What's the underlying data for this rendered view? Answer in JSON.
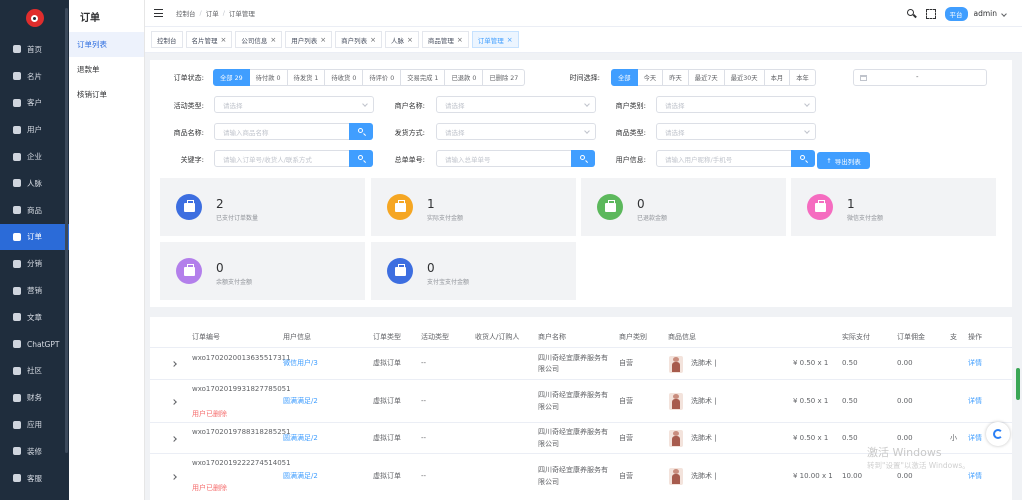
{
  "nav": {
    "items": [
      {
        "label": "首页",
        "icon": "home-icon"
      },
      {
        "label": "名片",
        "icon": "card-icon"
      },
      {
        "label": "客户",
        "icon": "customer-icon"
      },
      {
        "label": "用户",
        "icon": "user-icon"
      },
      {
        "label": "企业",
        "icon": "company-icon"
      },
      {
        "label": "人脉",
        "icon": "network-icon"
      },
      {
        "label": "商品",
        "icon": "goods-icon"
      },
      {
        "label": "订单",
        "icon": "order-icon",
        "active": true
      },
      {
        "label": "分销",
        "icon": "distribution-icon"
      },
      {
        "label": "营销",
        "icon": "marketing-icon"
      },
      {
        "label": "文章",
        "icon": "article-icon"
      },
      {
        "label": "ChatGPT",
        "icon": "chatgpt-icon"
      },
      {
        "label": "社区",
        "icon": "community-icon"
      },
      {
        "label": "财务",
        "icon": "finance-icon"
      },
      {
        "label": "应用",
        "icon": "apps-icon"
      },
      {
        "label": "装修",
        "icon": "decorate-icon"
      },
      {
        "label": "客服",
        "icon": "service-icon"
      }
    ]
  },
  "sub": {
    "title": "订单",
    "items": [
      {
        "label": "订单列表"
      },
      {
        "label": "退款单"
      },
      {
        "label": "核销订单"
      }
    ]
  },
  "header": {
    "breadcrumb": [
      "控制台",
      "订单",
      "订单管理"
    ],
    "platform": "平台",
    "user": "admin"
  },
  "tabs": [
    "控制台",
    "名片管理",
    "公司信息",
    "用户列表",
    "商户列表",
    "人脉",
    "商品管理",
    "订单管理"
  ],
  "filters": {
    "status_label": "订单状态:",
    "status_options": [
      "全部 29",
      "待付款 0",
      "待发货 1",
      "待收货 0",
      "待评价 0",
      "交易完成 1",
      "已退款 0",
      "已删除 27"
    ],
    "time_label": "时间选择:",
    "time_options": [
      "全部",
      "今天",
      "昨天",
      "最近7天",
      "最近30天",
      "本月",
      "本年"
    ],
    "date_sep": "-",
    "activity_type_label": "活动类型:",
    "activity_type_placeholder": "请选择",
    "merchant_name_label": "商户名称:",
    "merchant_name_placeholder": "请选择",
    "merchant_type_label": "商户类别:",
    "merchant_type_placeholder": "请选择",
    "product_name_label": "商品名称:",
    "product_name_placeholder": "请输入商品名称",
    "ship_method_label": "发货方式:",
    "ship_method_placeholder": "请选择",
    "product_type_label": "商品类型:",
    "product_type_placeholder": "请选择",
    "keyword_label": "关键字:",
    "keyword_placeholder": "请输入订单号/收货人/联系方式",
    "master_order_label": "总单单号:",
    "master_order_placeholder": "请输入总单单号",
    "user_info_label": "用户信息:",
    "user_info_placeholder": "请输入用户昵称/手机号",
    "export_label": "导出列表"
  },
  "stats": [
    {
      "value": "2",
      "label": "已支付订单数量",
      "color": "#3d6ee0"
    },
    {
      "value": "1",
      "label": "实际支付金额",
      "color": "#f5a623"
    },
    {
      "value": "0",
      "label": "已退款金额",
      "color": "#5cb85c"
    },
    {
      "value": "1",
      "label": "微信支付金额",
      "color": "#f56cc0"
    },
    {
      "value": "0",
      "label": "余额支付金额",
      "color": "#b37feb"
    },
    {
      "value": "0",
      "label": "支付宝支付金额",
      "color": "#3d6ee0"
    }
  ],
  "table": {
    "headers": [
      "订单编号",
      "用户信息",
      "订单类型",
      "活动类型",
      "收货人/订购人",
      "商户名称",
      "商户类别",
      "商品信息",
      "实际支付",
      "订单佣金",
      "支",
      "操作"
    ],
    "rows": [
      {
        "order_no": "wxo1702020013635517311",
        "user": "微信用户/3",
        "deleted": "",
        "type": "虚拟订单",
        "activity": "--",
        "merchant": "四川奇经宜康养服务有限公司",
        "category": "自营",
        "product": "洗肺术 |",
        "price": "¥ 0.50 x 1",
        "paid": "0.50",
        "commission": "0.00",
        "pay": "",
        "action": "详情"
      },
      {
        "order_no": "wxo1702019931827785051",
        "user": "圆满满足/2",
        "deleted": "用户已删除",
        "type": "虚拟订单",
        "activity": "--",
        "merchant": "四川奇经宜康养服务有限公司",
        "category": "自营",
        "product": "洗肺术 |",
        "price": "¥ 0.50 x 1",
        "paid": "0.50",
        "commission": "0.00",
        "pay": "",
        "action": "详情"
      },
      {
        "order_no": "wxo1702019788318285251",
        "user": "圆满满足/2",
        "deleted": "",
        "type": "虚拟订单",
        "activity": "--",
        "merchant": "四川奇经宜康养服务有限公司",
        "category": "自营",
        "product": "洗肺术 |",
        "price": "¥ 0.50 x 1",
        "paid": "0.50",
        "commission": "0.00",
        "pay": "小",
        "action": "详情"
      },
      {
        "order_no": "wxo1702019222274514051",
        "user": "圆满满足/2",
        "deleted": "用户已删除",
        "type": "虚拟订单",
        "activity": "--",
        "merchant": "四川奇经宜康养服务有限公司",
        "category": "自营",
        "product": "洗肺术 |",
        "price": "¥ 10.00 x 1",
        "paid": "10.00",
        "commission": "0.00",
        "pay": "",
        "action": "详情"
      }
    ]
  },
  "watermark": {
    "line1": "激活 Windows",
    "line2": "转到\"设置\"以激活 Windows。"
  }
}
